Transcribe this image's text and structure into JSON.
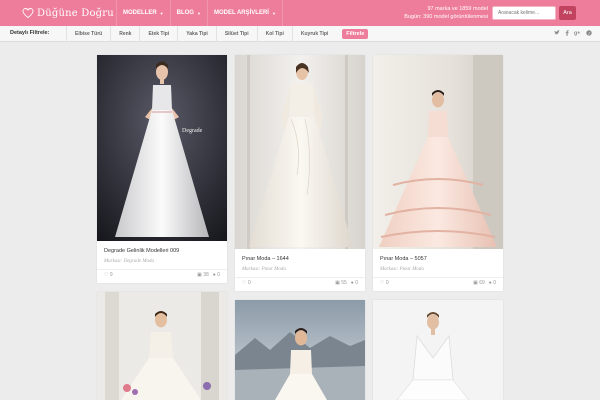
{
  "header": {
    "logo_text": "Düğüne Doğru",
    "nav": [
      "MODELLER",
      "BLOG",
      "MODEL ARŞİVLERİ"
    ],
    "stats_line1": "97 marka ve 1859 model",
    "stats_line2": "Bugün: 390 model görüntülenmesi",
    "search_placeholder": "Aranacak kelime...",
    "search_button": "Ara"
  },
  "filters": {
    "title": "Detaylı Filtrele:",
    "items": [
      "Elbise Türü",
      "Renk",
      "Etek Tipi",
      "Yaka Tipi",
      "Silüet Tipi",
      "Kol Tipi",
      "Kuyruk Tipi"
    ],
    "apply": "Filtrele",
    "social": [
      "twitter-icon",
      "facebook-icon",
      "google-plus-icon",
      "pinterest-icon"
    ]
  },
  "cards": [
    {
      "title": "Degrade Gelinlik Modelleri 009",
      "brand": "Markası: Degrade Moda",
      "likes": "9",
      "photos": "38",
      "comments": "0"
    },
    {
      "title": "Pınar Moda – 1644",
      "brand": "Markası: Pınar Moda",
      "likes": "0",
      "photos": "55",
      "comments": "0"
    },
    {
      "title": "Pınar Moda – 5057",
      "brand": "Markası: Pınar Moda",
      "likes": "0",
      "photos": "69",
      "comments": "0"
    }
  ]
}
